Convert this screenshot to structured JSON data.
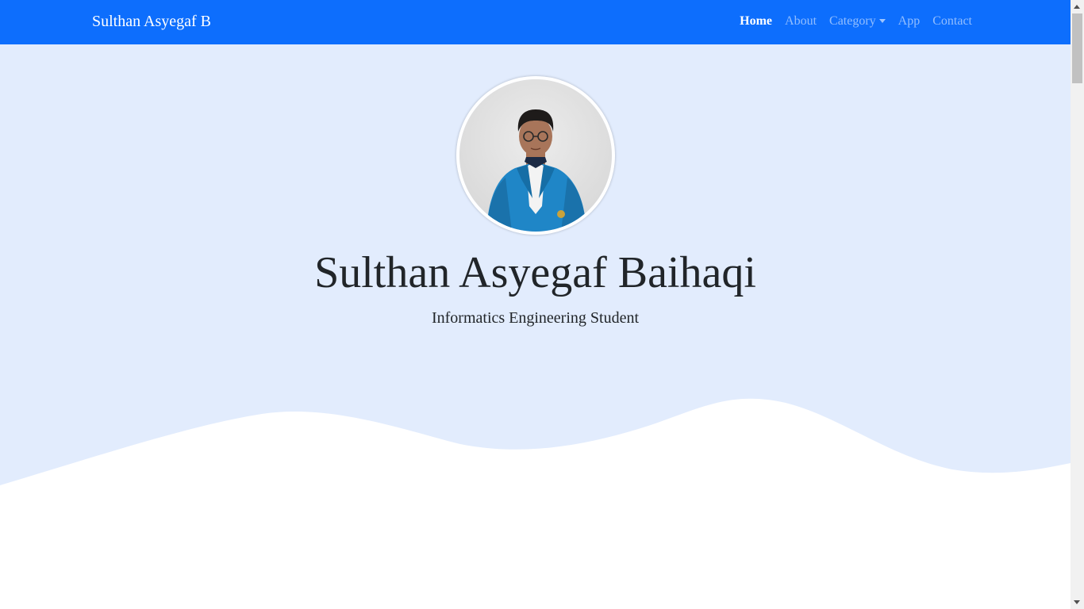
{
  "navbar": {
    "brand": "Sulthan Asyegaf B",
    "links": [
      {
        "label": "Home",
        "active": true
      },
      {
        "label": "About",
        "active": false
      },
      {
        "label": "Category",
        "active": false,
        "dropdown": true
      },
      {
        "label": "App",
        "active": false
      },
      {
        "label": "Contact",
        "active": false
      }
    ]
  },
  "hero": {
    "title": "Sulthan Asyegaf Baihaqi",
    "subtitle": "Informatics Engineering Student",
    "avatar_icon": "profile-photo"
  },
  "colors": {
    "navbar_bg": "#0d6efd",
    "hero_bg": "#e2ecfd",
    "wave_fill": "#ffffff",
    "text": "#212529",
    "link_muted": "rgba(255,255,255,0.55)"
  }
}
